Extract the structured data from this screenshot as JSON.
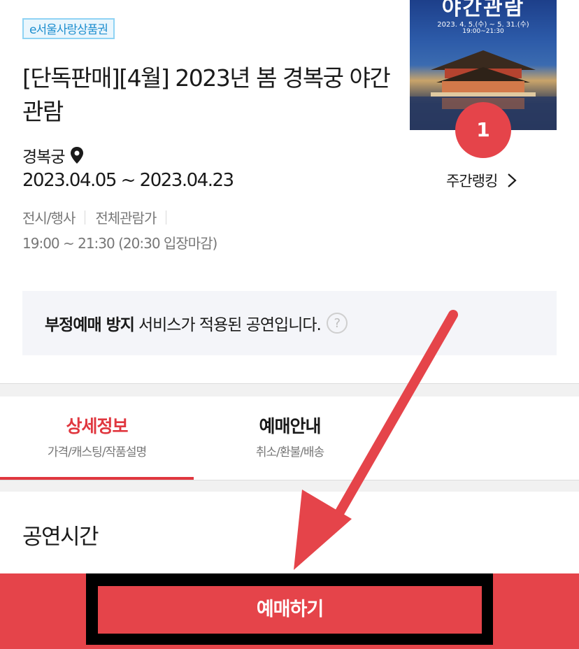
{
  "badge": "e서울사랑상품권",
  "title": "[단독판매][4월] 2023년 봄 경복궁 야간관람",
  "poster": {
    "title": "야간관람",
    "dates": "2023. 4. 5.(수) ~ 5. 31.(수)",
    "time": "19:00~21:30"
  },
  "rank": "1",
  "weekly_ranking": "주간랭킹",
  "venue": "경복궁",
  "dates": "2023.04.05 ~ 2023.04.23",
  "category": "전시/행사",
  "age": "전체관람가",
  "showtime": "19:00 ~ 21:30 (20:30 입장마감)",
  "notice": {
    "bold": "부정예매 방지",
    "text": "서비스가 적용된 공연입니다.",
    "help": "?"
  },
  "tabs": [
    {
      "label": "상세정보",
      "sub": "가격/캐스팅/작품설명"
    },
    {
      "label": "예매안내",
      "sub": "취소/환불/배송"
    }
  ],
  "section_title": "공연시간",
  "faded_text": "...",
  "book_button": "예매하기",
  "colors": {
    "accent": "#e5444a",
    "tab_active": "#e0373f",
    "badge": "#1f8fcf"
  }
}
